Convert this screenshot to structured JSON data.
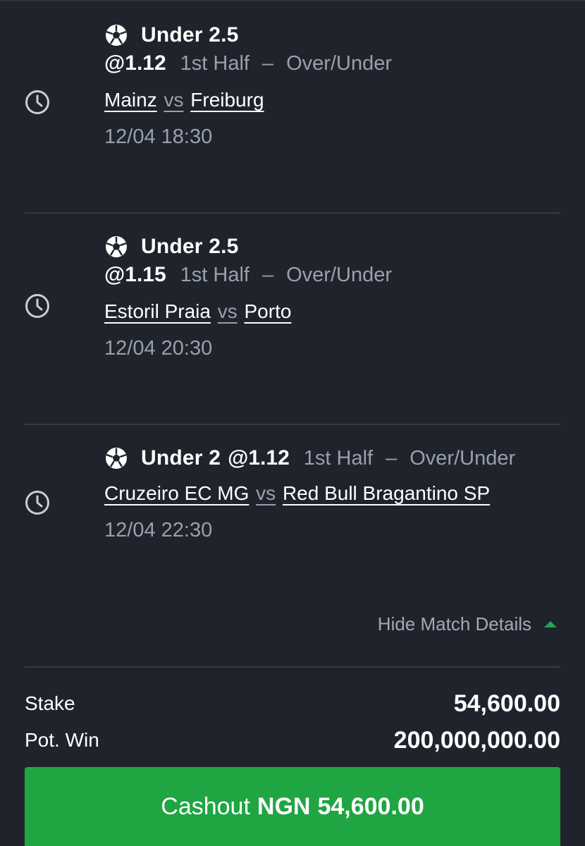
{
  "bets": [
    {
      "pick": "Under 2.5",
      "odds": "@1.12",
      "market_period": "1st Half",
      "market_separator": "–",
      "market_type": "Over/Under",
      "home_team": "Mainz",
      "vs": "vs",
      "away_team": "Freiburg",
      "time": "12/04 18:30"
    },
    {
      "pick": "Under 2.5",
      "odds": "@1.15",
      "market_period": "1st Half",
      "market_separator": "–",
      "market_type": "Over/Under",
      "home_team": "Estoril Praia",
      "vs": "vs",
      "away_team": "Porto",
      "time": "12/04 20:30"
    },
    {
      "pick": "Under 2",
      "odds": "@1.12",
      "market_period": "1st Half",
      "market_separator": "–",
      "market_type": "Over/Under",
      "home_team": "Cruzeiro EC MG",
      "vs": "vs",
      "away_team": "Red Bull Bragantino SP",
      "time": "12/04 22:30"
    }
  ],
  "details_toggle": {
    "label": "Hide Match Details"
  },
  "summary": {
    "stake_label": "Stake",
    "stake_value": "54,600.00",
    "pot_win_label": "Pot. Win",
    "pot_win_value": "200,000,000.00"
  },
  "cashout": {
    "label": "Cashout",
    "currency": "NGN",
    "amount": "54,600.00"
  },
  "icons": {
    "clock": "clock-icon",
    "ball": "soccer-ball-icon",
    "toggle": "caret-up-icon"
  },
  "colors": {
    "background": "#1f232c",
    "accent_green": "#1fa542",
    "muted_text": "#9aa0ab"
  }
}
